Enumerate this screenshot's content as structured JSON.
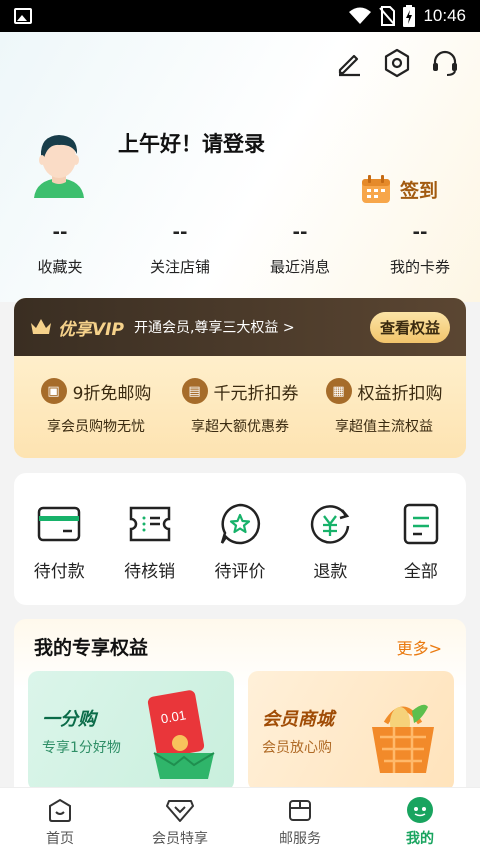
{
  "status_bar": {
    "time": "10:46"
  },
  "header": {
    "greeting": "上午好！请登录",
    "signin_label": "签到"
  },
  "stats": [
    {
      "value": "--",
      "label": "收藏夹"
    },
    {
      "value": "--",
      "label": "关注店铺"
    },
    {
      "value": "--",
      "label": "最近消息"
    },
    {
      "value": "--",
      "label": "我的卡券"
    }
  ],
  "vip": {
    "title": "优享VIP",
    "subtitle": "开通会员,尊享三大权益 >",
    "button": "查看权益",
    "perks": [
      {
        "title": "9折免邮购",
        "desc": "享会员购物无忧"
      },
      {
        "title": "千元折扣券",
        "desc": "享超大额优惠券"
      },
      {
        "title": "权益折扣购",
        "desc": "享超值主流权益"
      }
    ]
  },
  "orders": [
    {
      "label": "待付款",
      "icon": "card-icon"
    },
    {
      "label": "待核销",
      "icon": "ticket-icon"
    },
    {
      "label": "待评价",
      "icon": "star-bubble-icon"
    },
    {
      "label": "退款",
      "icon": "refund-icon"
    },
    {
      "label": "全部",
      "icon": "list-icon"
    }
  ],
  "rights": {
    "title": "我的专享权益",
    "more": "更多>",
    "promos": [
      {
        "title": "一分购",
        "subtitle": "专享1分好物",
        "badge": "0.01"
      },
      {
        "title": "会员商城",
        "subtitle": "会员放心购"
      }
    ]
  },
  "tabbar": [
    {
      "label": "首页",
      "icon": "home-icon"
    },
    {
      "label": "会员特享",
      "icon": "member-icon"
    },
    {
      "label": "邮服务",
      "icon": "box-icon"
    },
    {
      "label": "我的",
      "icon": "profile-icon",
      "active": true
    }
  ],
  "colors": {
    "accent_green": "#19a45f",
    "vip_gold": "#f6d28b",
    "more_orange": "#ea7a10"
  }
}
